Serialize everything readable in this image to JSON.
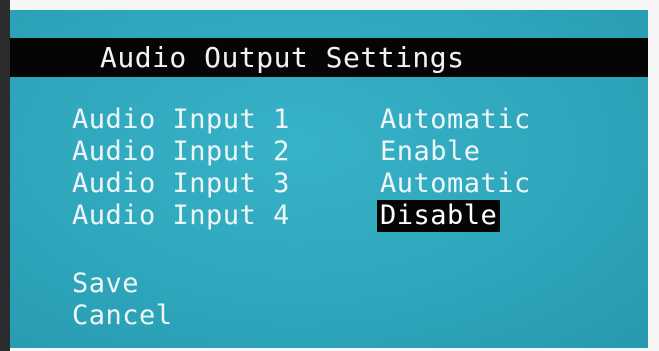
{
  "menu": {
    "title": "Audio Output Settings",
    "rows": [
      {
        "label": "Audio Input 1",
        "value": "Automatic",
        "selected": false
      },
      {
        "label": "Audio Input 2",
        "value": "Enable",
        "selected": false
      },
      {
        "label": "Audio Input 3",
        "value": "Automatic",
        "selected": false
      },
      {
        "label": "Audio Input 4",
        "value": "Disable",
        "selected": true
      }
    ],
    "actions": {
      "save": "Save",
      "cancel": "Cancel"
    }
  },
  "colors": {
    "screen_background": "#2fa8bf",
    "title_bar": "#050505",
    "text": "#eef7f8",
    "selection_highlight": "#050505"
  }
}
